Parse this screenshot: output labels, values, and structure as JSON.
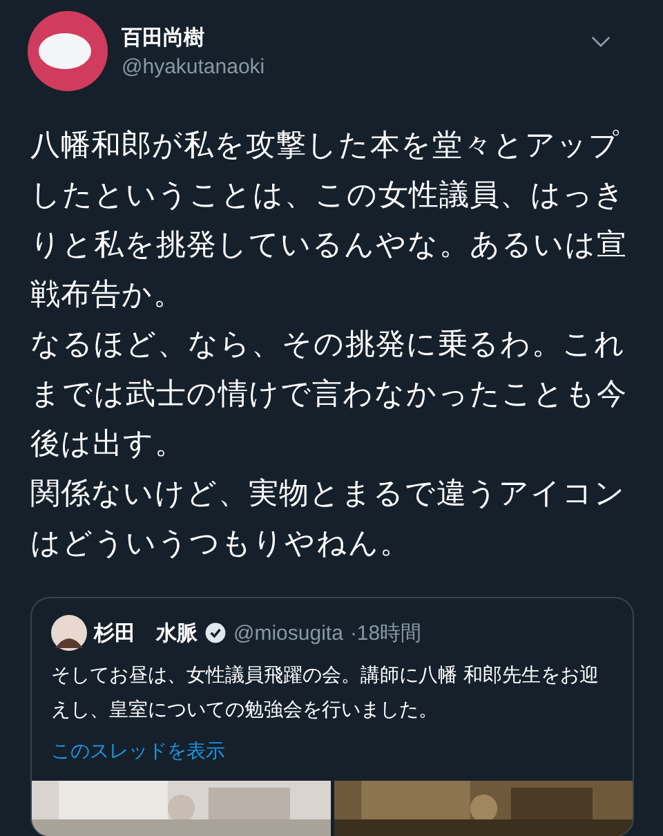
{
  "tweet": {
    "author": {
      "name": "百田尚樹",
      "handle": "@hyakutanaoki"
    },
    "paragraphs": [
      "八幡和郎が私を攻撃した本を堂々とアップしたということは、この女性議員、はっきりと私を挑発しているんやな。あるいは宣戦布告か。",
      "なるほど、なら、その挑発に乗るわ。これまでは武士の情けで言わなかったことも今後は出す。",
      "関係ないけど、実物とまるで違うアイコンはどういうつもりやねん。"
    ],
    "quoted": {
      "name": "杉田　水脈",
      "verified": true,
      "handle": "@miosugita",
      "time": "·18時間",
      "text": "そしてお昼は、女性議員飛躍の会。講師に八幡 和郎先生をお迎えし、皇室についての勉強会を行いました。",
      "link": "このスレッドを表示"
    }
  }
}
